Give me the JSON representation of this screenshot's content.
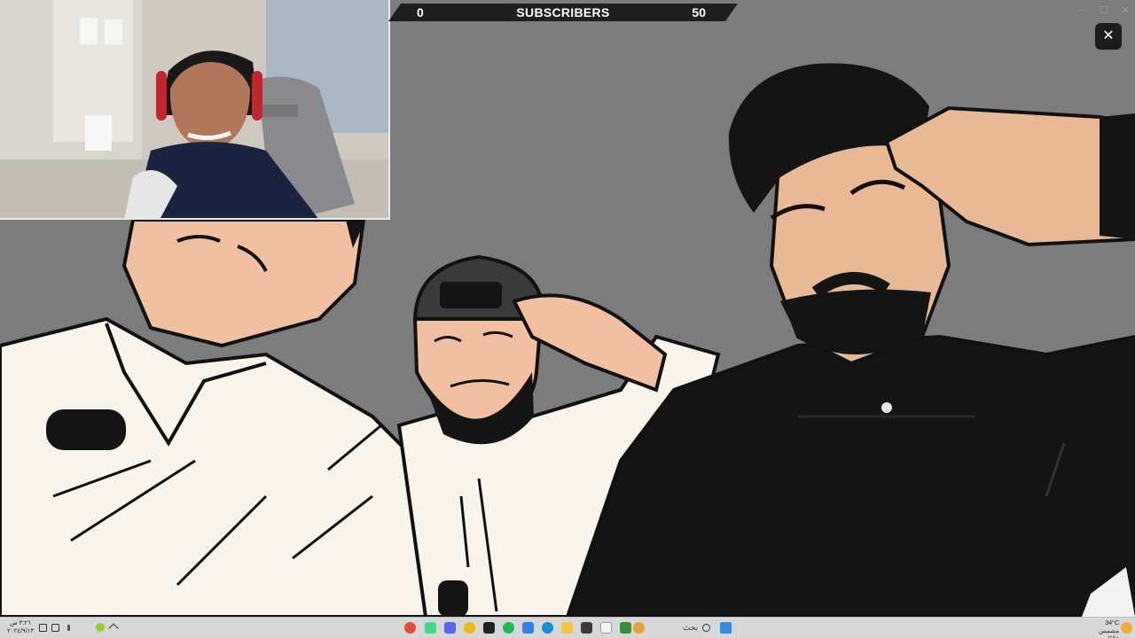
{
  "goal": {
    "min_value": "0",
    "title": "SUBSCRIBERS",
    "max_value": "50",
    "progress": 0
  },
  "window": {
    "close_symbol": "✕",
    "minimize_symbol": "─",
    "maximize_symbol": "☐",
    "window_close_symbol": "✕"
  },
  "taskbar": {
    "clock_time": "٣:٢٦ ص",
    "clock_date": "٢٠٢٤/٩/١٣",
    "search_label": "بحث",
    "weather_temp": "34°C",
    "weather_desc": "مشمس غالبًا",
    "icons": [
      {
        "name": "chrome-icon",
        "color": "#e84b3a"
      },
      {
        "name": "android-icon",
        "color": "#3ddc84"
      },
      {
        "name": "discord-icon",
        "color": "#5865f2"
      },
      {
        "name": "chrome-alt-icon",
        "color": "#f2b705"
      },
      {
        "name": "terminal-icon",
        "color": "#222222"
      },
      {
        "name": "spotify-icon",
        "color": "#1db954"
      },
      {
        "name": "vscode-icon",
        "color": "#2f80ed"
      },
      {
        "name": "edge-icon",
        "color": "#0f8fd6"
      },
      {
        "name": "explorer-icon",
        "color": "#f5c542"
      },
      {
        "name": "store-icon",
        "color": "#3a3a3a"
      },
      {
        "name": "notepad-icon",
        "color": "#f4f4f4"
      },
      {
        "name": "xbox-icon",
        "color": "#3c8a3c"
      },
      {
        "name": "obs-icon",
        "color": "#e8a03a"
      }
    ],
    "tray_icons": [
      "speaker-icon",
      "network-icon",
      "battery-icon",
      "chevron-up-icon",
      "color-icon"
    ],
    "start_color": "#2f8de4"
  },
  "colors": {
    "background": "#7c7c7c",
    "white_clothing": "#f8f4ec",
    "black_clothing": "#141414",
    "skin": "#f0c0a0",
    "goal_bar": "#1f1f1f"
  }
}
